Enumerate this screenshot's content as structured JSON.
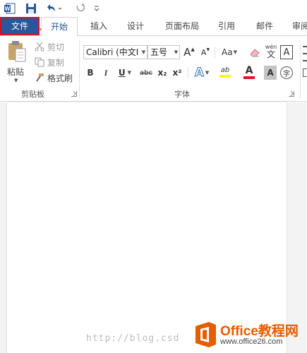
{
  "qat": {
    "icons": [
      "word-app-icon",
      "save-icon",
      "undo-icon",
      "redo-icon",
      "customize-qat-icon"
    ]
  },
  "tabs": [
    {
      "label": "文件",
      "state": "file-highlighted"
    },
    {
      "label": "开始",
      "state": "active"
    },
    {
      "label": "插入"
    },
    {
      "label": "设计"
    },
    {
      "label": "页面布局"
    },
    {
      "label": "引用"
    },
    {
      "label": "邮件"
    },
    {
      "label": "审阅"
    }
  ],
  "clipboard": {
    "paste_label": "粘贴",
    "cut_label": "剪切",
    "copy_label": "复制",
    "format_painter_label": "格式刷",
    "group_label": "剪贴板"
  },
  "font": {
    "font_name": "Calibri (中文I",
    "font_size": "五号",
    "grow_label": "A",
    "shrink_label": "A",
    "change_case_label": "Aa",
    "phonetic_top": "wén",
    "phonetic_bottom": "文",
    "border_char_label": "A",
    "bold_label": "B",
    "italic_label": "I",
    "underline_label": "U",
    "strike_label": "abc",
    "subscript_label": "x₂",
    "superscript_label": "x²",
    "text_effects_label": "A",
    "highlight_label": "ab",
    "font_color_label": "A",
    "char_shading_label": "A",
    "enclose_label": "字",
    "group_label": "字体"
  },
  "watermark": {
    "blog_text": "http://blog.csd",
    "brand_name": "Office教程网",
    "brand_url": "www.office26.com"
  },
  "colors": {
    "file_tab": "#2b579a",
    "highlight_border": "#d0102a",
    "font_color_bar": "#e81123",
    "highlight_bar": "#ffff00",
    "brand_orange": "#e65c00"
  }
}
